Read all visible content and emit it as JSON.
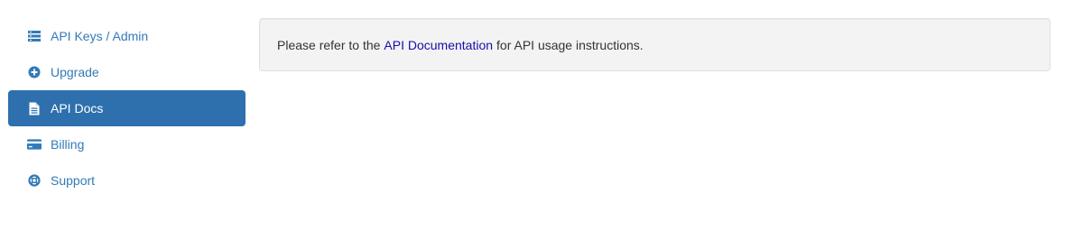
{
  "sidebar": {
    "items": [
      {
        "label": "API Keys / Admin",
        "icon": "list-icon",
        "active": false
      },
      {
        "label": "Upgrade",
        "icon": "plus-circle-icon",
        "active": false
      },
      {
        "label": "API Docs",
        "icon": "document-icon",
        "active": true
      },
      {
        "label": "Billing",
        "icon": "credit-card-icon",
        "active": false
      },
      {
        "label": "Support",
        "icon": "lifebuoy-icon",
        "active": false
      }
    ]
  },
  "main": {
    "notice": {
      "prefix": "Please refer to the",
      "link_text": "API Documentation",
      "suffix": "for API usage instructions."
    }
  },
  "colors": {
    "link": "#337ab7",
    "active_bg": "#2e70ae",
    "inline_link": "#1a0dab",
    "well_bg": "#f3f3f3"
  }
}
